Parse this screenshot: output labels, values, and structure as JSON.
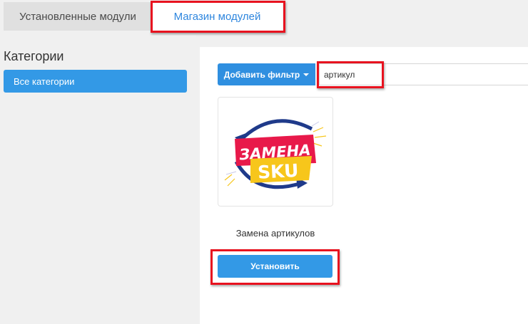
{
  "tabs": {
    "installed_label": "Установленные модули",
    "store_label": "Магазин модулей"
  },
  "sidebar": {
    "title": "Категории",
    "items": [
      {
        "label": "Все категории"
      }
    ]
  },
  "filter": {
    "add_filter_label": "Добавить фильтр",
    "search_value": "артикул"
  },
  "module": {
    "logo_text_line1": "ЗАМЕНА",
    "logo_text_line2": "SKU",
    "name": "Замена артикулов",
    "install_label": "Установить"
  },
  "colors": {
    "accent": "#3399e6",
    "highlight": "#e8121f",
    "logo_red": "#e8194a",
    "logo_yellow": "#f7c61b",
    "logo_navy": "#1f3a8a"
  }
}
